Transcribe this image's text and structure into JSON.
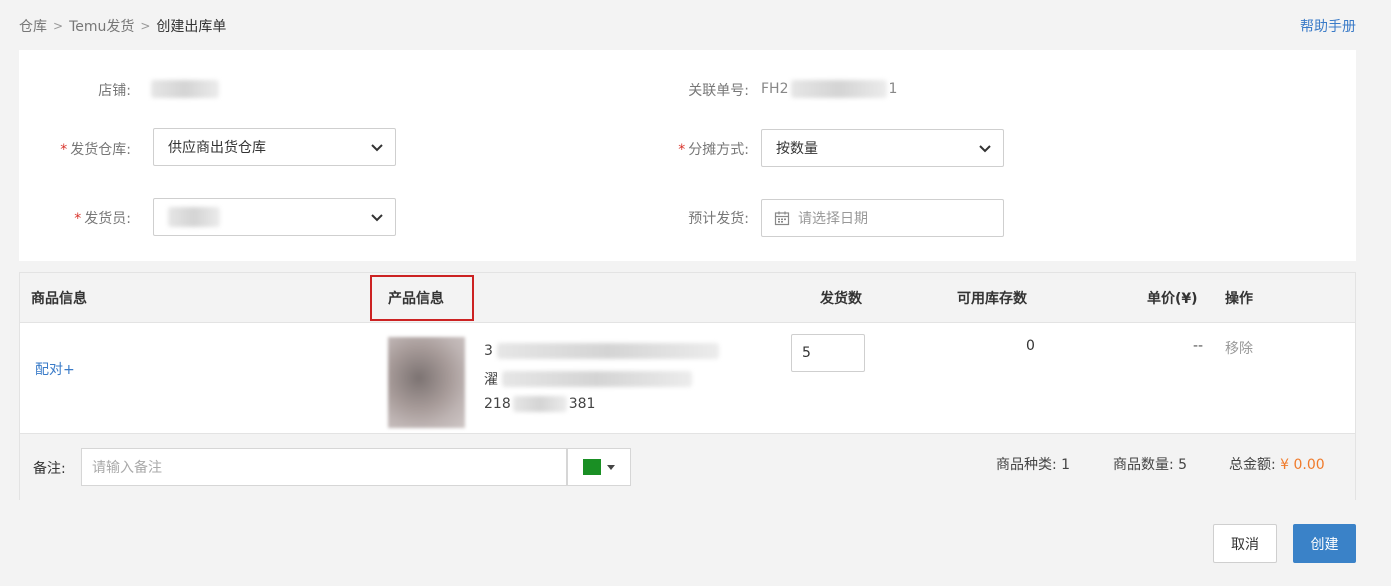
{
  "breadcrumb": [
    "仓库",
    "Temu发货",
    "创建出库单"
  ],
  "help_link": "帮助手册",
  "form": {
    "shop_label": "店铺:",
    "related_no_label": "关联单号:",
    "related_no_prefix": "FH2",
    "related_no_suffix": "1",
    "warehouse_label": "发货仓库:",
    "warehouse_value": "供应商出货仓库",
    "allocation_label": "分摊方式:",
    "allocation_value": "按数量",
    "shipper_label": "发货员:",
    "eta_label": "预计发货:",
    "eta_placeholder": "请选择日期",
    "required_mark": "*"
  },
  "table": {
    "headers": {
      "goods_info": "商品信息",
      "product_info": "产品信息",
      "ship_qty": "发货数",
      "available_stock": "可用库存数",
      "unit_price": "单价(¥)",
      "actions": "操作"
    },
    "row": {
      "pair_link": "配对+",
      "product_line1_start": "3",
      "product_line2_start": "濯",
      "sku_prefix": "218",
      "sku_suffix": "381",
      "ship_qty": "5",
      "available_stock": "0",
      "unit_price": "--",
      "remove": "移除"
    }
  },
  "footer": {
    "remark_label": "备注:",
    "remark_placeholder": "请输入备注",
    "swatch_color": "#1a8f24",
    "kinds_label": "商品种类:",
    "kinds_value": "1",
    "count_label": "商品数量:",
    "count_value": "5",
    "total_label": "总金额:",
    "total_value": "¥ 0.00"
  },
  "buttons": {
    "cancel": "取消",
    "create": "创建"
  }
}
